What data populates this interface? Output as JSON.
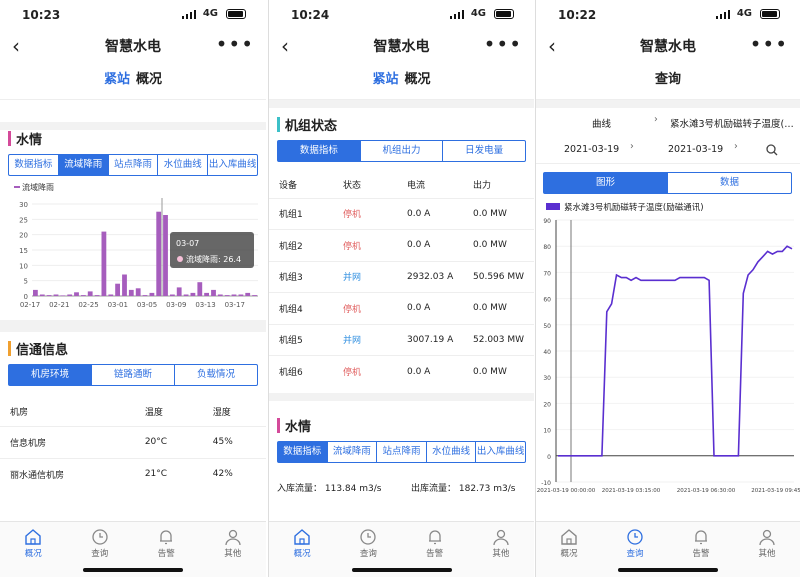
{
  "app_title": "智慧水电",
  "phone1": {
    "time": "10:23",
    "network": "4G",
    "subnav": {
      "active": "紧站",
      "other": "概况"
    },
    "water": {
      "title": "水情",
      "tabs": [
        "数据指标",
        "流域降雨",
        "站点降雨",
        "水位曲线",
        "出入库曲线"
      ],
      "active_tab": 1
    },
    "comm": {
      "title": "信通信息",
      "tabs": [
        "机房环境",
        "链路通断",
        "负载情况"
      ],
      "active_tab": 0,
      "headers": [
        "机房",
        "温度",
        "湿度"
      ],
      "rows": [
        [
          "信息机房",
          "20°C",
          "45%"
        ],
        [
          "丽水通信机房",
          "21°C",
          "42%"
        ]
      ]
    }
  },
  "phone2": {
    "time": "10:24",
    "network": "4G",
    "subnav": {
      "active": "紧站",
      "other": "概况"
    },
    "units": {
      "title": "机组状态",
      "tabs": [
        "数据指标",
        "机组出力",
        "日发电量"
      ],
      "active_tab": 0,
      "headers": [
        "设备",
        "状态",
        "电流",
        "出力"
      ],
      "rows": [
        [
          "机组1",
          "停机",
          "0.0 A",
          "0.0 MW"
        ],
        [
          "机组2",
          "停机",
          "0.0 A",
          "0.0 MW"
        ],
        [
          "机组3",
          "并网",
          "2932.03 A",
          "50.596 MW"
        ],
        [
          "机组4",
          "停机",
          "0.0 A",
          "0.0 MW"
        ],
        [
          "机组5",
          "并网",
          "3007.19 A",
          "52.003 MW"
        ],
        [
          "机组6",
          "停机",
          "0.0 A",
          "0.0 MW"
        ]
      ]
    },
    "water": {
      "title": "水情",
      "tabs": [
        "数据指标",
        "流域降雨",
        "站点降雨",
        "水位曲线",
        "出入库曲线"
      ],
      "active_tab": 0,
      "inflow": "入库流量：  113.84 m3/s",
      "outflow": "出库流量：  182.73 m3/s"
    }
  },
  "phone3": {
    "time": "10:22",
    "network": "4G",
    "nav_title": "查询",
    "curve_label": "曲线",
    "curve_value": "紧水滩3号机励磁转子温度(…",
    "date_start": "2021-03-19",
    "date_end": "2021-03-19",
    "tabs": [
      "图形",
      "数据"
    ],
    "active_tab": 0
  },
  "tabbar": [
    "概况",
    "查询",
    "告警",
    "其他"
  ],
  "colors": {
    "accent": "#2e6fe0",
    "bar": "#a65dbd",
    "line": "#5a2fd0",
    "water_bar": "#d44a9a",
    "comm_bar": "#f0a030",
    "units_bar": "#3cc0c8"
  },
  "chart_data": [
    {
      "type": "bar",
      "legend": "流域降雨",
      "ylabels": [
        "30",
        "25",
        "20",
        "15",
        "10",
        "5",
        "0"
      ],
      "ylim": [
        0,
        30
      ],
      "categories": [
        "02-17",
        "02-21",
        "02-25",
        "03-01",
        "03-05",
        "03-09",
        "03-13",
        "03-17"
      ],
      "values": [
        2,
        0.5,
        0.3,
        0.5,
        0.2,
        0.5,
        1.2,
        0.3,
        1.5,
        0.3,
        21,
        0.5,
        4,
        7,
        2,
        2.5,
        0.3,
        1,
        27.5,
        26.4,
        0.5,
        2.8,
        0.5,
        1,
        4.5,
        1,
        2,
        0.5,
        0.3,
        0.5,
        0.5,
        1,
        0.3
      ],
      "tooltip_date": "03-07",
      "tooltip_text": "流域降雨: 26.4"
    },
    {
      "type": "line",
      "legend": "紧水滩3号机励磁转子温度(励磁通讯)",
      "ylabels": [
        "90",
        "80",
        "70",
        "60",
        "50",
        "40",
        "30",
        "20",
        "10",
        "0",
        "-10"
      ],
      "ylim": [
        -10,
        90
      ],
      "xlabels": [
        "2021-03-19 00:00:00",
        "2021-03-19 03:15:00",
        "2021-03-19 06:30:00",
        "2021-03-19 09:45"
      ],
      "values": [
        0,
        0,
        0,
        0,
        0,
        0,
        0,
        0,
        0,
        0,
        55,
        58,
        69,
        68,
        68,
        67,
        68,
        67,
        67,
        67,
        67,
        67,
        67,
        67,
        67,
        68,
        68,
        68,
        68,
        68,
        68,
        67,
        0,
        0,
        0,
        0,
        0,
        0,
        62,
        69,
        71,
        74,
        76,
        78,
        77,
        78,
        78,
        80,
        79
      ]
    }
  ]
}
